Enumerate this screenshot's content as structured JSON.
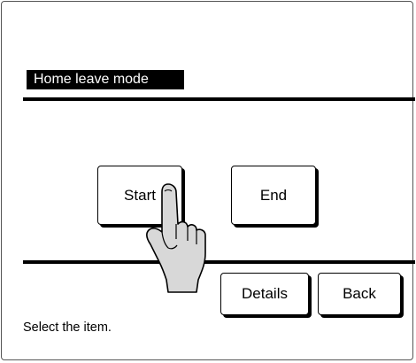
{
  "screen": {
    "title": "Home leave mode",
    "buttons": {
      "start": "Start",
      "end": "End",
      "details": "Details",
      "back": "Back"
    },
    "status_text": "Select the item."
  },
  "icons": {
    "pointer": "pointing-hand-icon"
  }
}
